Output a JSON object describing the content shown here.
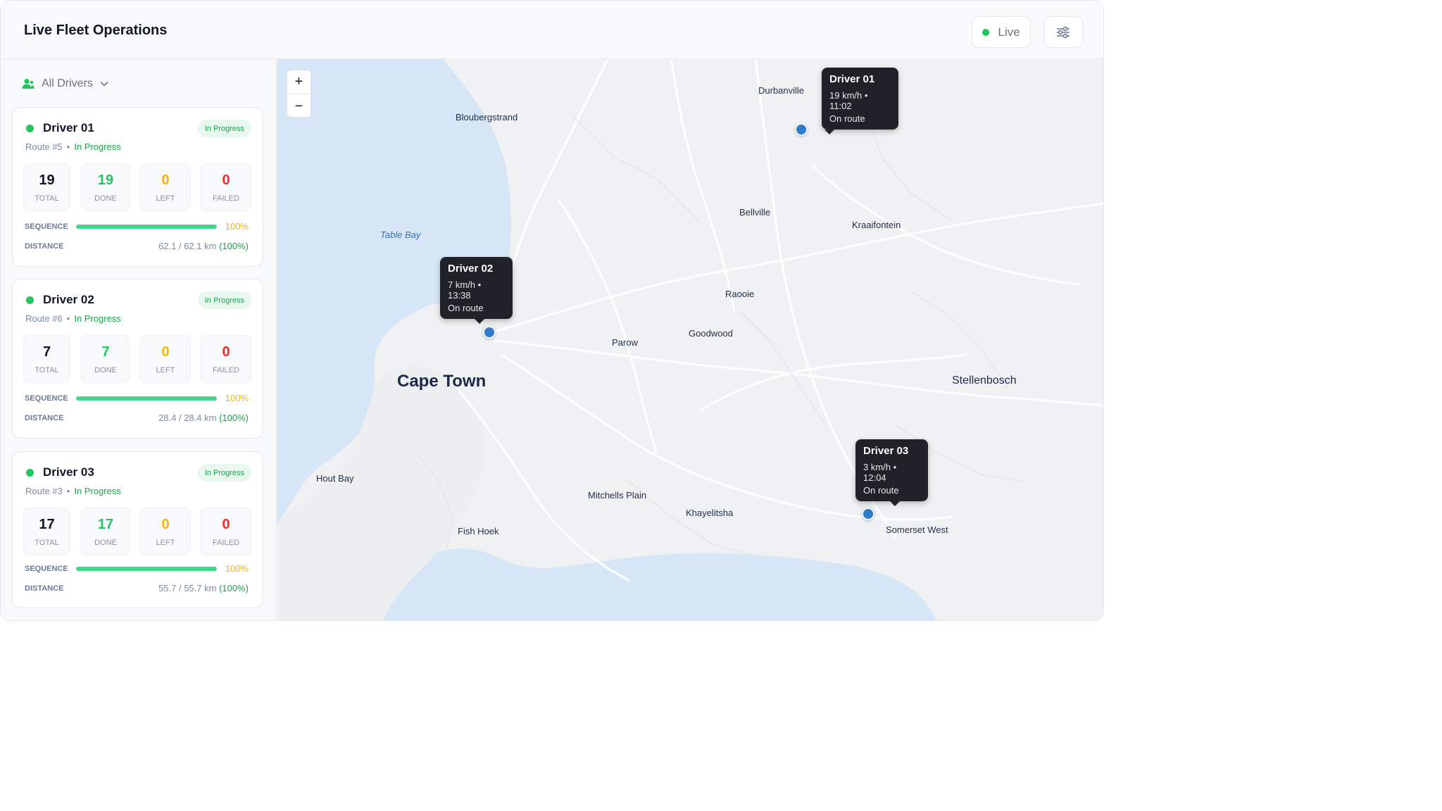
{
  "header": {
    "title": "Live Fleet Operations",
    "live_label": "Live",
    "settings_icon": "sliders-icon"
  },
  "sidebar": {
    "filter_label": "All Drivers",
    "cards": [
      {
        "name": "Driver 01",
        "badge": "In Progress",
        "route": "Route #5",
        "separator": "•",
        "route_status": "In Progress",
        "total": "19",
        "done": "19",
        "left": "0",
        "failed": "0",
        "total_label": "TOTAL",
        "done_label": "DONE",
        "left_label": "LEFT",
        "failed_label": "FAILED",
        "sequence_label": "SEQUENCE",
        "sequence_pct": "100%",
        "sequence_fraction": 1.0,
        "distance_label": "DISTANCE",
        "distance": "62.1 / 62.1 km",
        "distance_pct": "(100%)"
      },
      {
        "name": "Driver 02",
        "badge": "In Progress",
        "route": "Route #6",
        "separator": "•",
        "route_status": "In Progress",
        "total": "7",
        "done": "7",
        "left": "0",
        "failed": "0",
        "total_label": "TOTAL",
        "done_label": "DONE",
        "left_label": "LEFT",
        "failed_label": "FAILED",
        "sequence_label": "SEQUENCE",
        "sequence_pct": "100%",
        "sequence_fraction": 1.0,
        "distance_label": "DISTANCE",
        "distance": "28.4 / 28.4 km",
        "distance_pct": "(100%)"
      },
      {
        "name": "Driver 03",
        "badge": "In Progress",
        "route": "Route #3",
        "separator": "•",
        "route_status": "In Progress",
        "total": "17",
        "done": "17",
        "left": "0",
        "failed": "0",
        "total_label": "TOTAL",
        "done_label": "DONE",
        "left_label": "LEFT",
        "failed_label": "FAILED",
        "sequence_label": "SEQUENCE",
        "sequence_pct": "100%",
        "sequence_fraction": 1.0,
        "distance_label": "DISTANCE",
        "distance": "55.7 / 55.7 km",
        "distance_pct": "(100%)"
      }
    ]
  },
  "map": {
    "zoom_in": "+",
    "zoom_out": "−",
    "places": {
      "durbanville": "Durbanville",
      "bloubergstrand": "Bloubergstrand",
      "bellville": "Bellville",
      "kraaifontein": "Kraaifontein",
      "table_bay": "Table Bay",
      "raooie": "Raooie",
      "parow": "Parow",
      "goodwood": "Goodwood",
      "cape_town": "Cape Town",
      "stellenbosch": "Stellenbosch",
      "hout_bay": "Hout Bay",
      "mitchells_plain": "Mitchells Plain",
      "khayelitsha": "Khayelitsha",
      "somerset_west": "Somerset West",
      "fish_hoek": "Fish Hoek"
    },
    "tooltips": [
      {
        "title": "Driver 01",
        "speed_time": "19 km/h • 11:02",
        "status": "On route"
      },
      {
        "title": "Driver 02",
        "speed_time": "7 km/h • 13:38",
        "status": "On route"
      },
      {
        "title": "Driver 03",
        "speed_time": "3 km/h • 12:04",
        "status": "On route"
      }
    ]
  },
  "colors": {
    "accent_green": "#22c55e",
    "left_amber": "#f5b50a",
    "failed_red": "#ef2b2b",
    "pin_blue": "#2f7bc7",
    "water": "#d6e6f7"
  }
}
